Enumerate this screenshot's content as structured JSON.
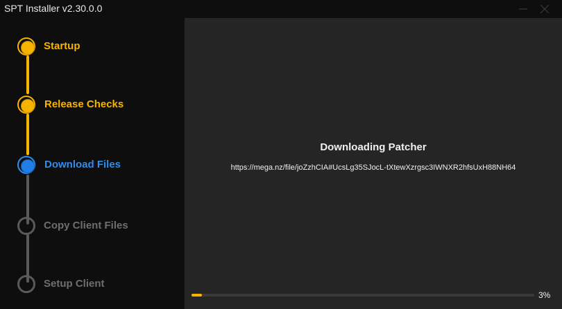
{
  "window": {
    "title": "SPT Installer v2.30.0.0"
  },
  "steps": [
    {
      "label": "Startup",
      "state": "done"
    },
    {
      "label": "Release Checks",
      "state": "done"
    },
    {
      "label": "Download Files",
      "state": "active"
    },
    {
      "label": "Copy Client Files",
      "state": "pending"
    },
    {
      "label": "Setup Client",
      "state": "pending"
    }
  ],
  "download": {
    "title": "Downloading Patcher",
    "url": "https://mega.nz/file/joZzhCIA#UcsLg35SJocL-tXtewXzrgsc3IWNXR2hfsUxH88NH64",
    "progress_percent": 3,
    "progress_text": "3%"
  },
  "colors": {
    "done": "#f6b400",
    "active": "#2f8df0",
    "pending": "#5a5a5a",
    "content_bg": "#252525",
    "sidebar_bg": "#0e0e0e"
  },
  "icons": {
    "minimize": "minimize-icon",
    "close": "close-icon"
  }
}
